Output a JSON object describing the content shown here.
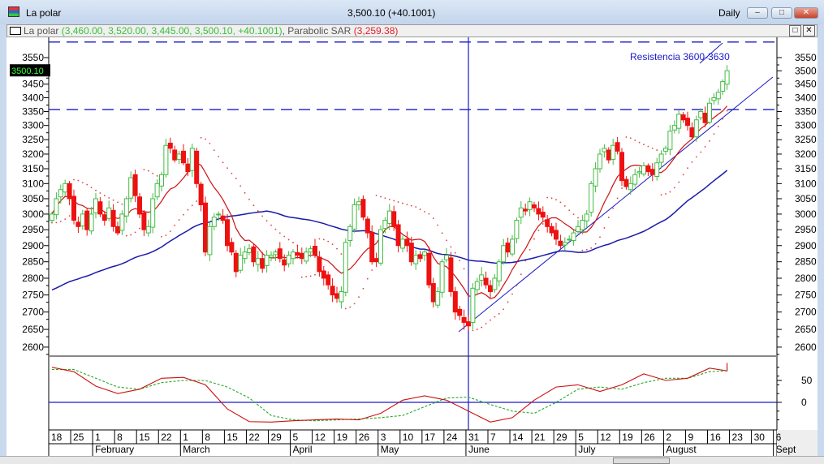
{
  "window": {
    "title": "La polar",
    "quote": "3,500.10 (+40.1001)",
    "period": "Daily",
    "minimize": "–",
    "maximize": "□",
    "close": "✕"
  },
  "legend": {
    "symbol": "La polar",
    "ohlc": "(3,460.00, 3,520.00, 3,445.00, 3,500.10, +40.1001)",
    "sep": ", ",
    "indicator": "Parabolic SAR",
    "indicator_value": "(3,259.38)",
    "restore": "□",
    "close": "✕"
  },
  "price_tag": "3500.10",
  "annotation": "Resistencia 3600-3630",
  "colors": {
    "up": "#44bb44",
    "down": "#ee1111",
    "ma_fast": "#cc1111",
    "ma_slow": "#1a1aa8",
    "sar": "#e04040",
    "lines": "#1a1ac8",
    "osc_red": "#cc1111",
    "osc_green": "#22aa22"
  },
  "chart_data": {
    "type": "candlestick",
    "title": "La polar",
    "scale": "log",
    "ylim": [
      2575,
      3620
    ],
    "yticks": [
      2600,
      2650,
      2700,
      2750,
      2800,
      2850,
      2900,
      2950,
      3000,
      3050,
      3100,
      3150,
      3200,
      3250,
      3300,
      3350,
      3400,
      3450,
      3500,
      3550
    ],
    "closes": [
      3000,
      3050,
      3080,
      3100,
      3050,
      2980,
      2960,
      3000,
      2950,
      3000,
      3050,
      3000,
      2980,
      3020,
      2960,
      2940,
      3000,
      3050,
      3120,
      3060,
      3000,
      2950,
      2960,
      3050,
      3100,
      3130,
      3230,
      3220,
      3180,
      3200,
      3170,
      3140,
      3220,
      3100,
      3030,
      2880,
      2960,
      2990,
      3000,
      2980,
      2900,
      2880,
      2820,
      2870,
      2880,
      2890,
      2850,
      2860,
      2830,
      2870,
      2870,
      2880,
      2860,
      2840,
      2870,
      2880,
      2870,
      2860,
      2880,
      2890,
      2870,
      2820,
      2800,
      2780,
      2750,
      2740,
      2760,
      2910,
      2960,
      3030,
      3040,
      2990,
      2940,
      2850,
      2850,
      2950,
      2980,
      3010,
      2960,
      2900,
      2920,
      2900,
      2850,
      2870,
      2860,
      2880,
      2780,
      2730,
      2760,
      2850,
      2870,
      2760,
      2700,
      2690,
      2670,
      2660,
      2770,
      2790,
      2810,
      2780,
      2760,
      2800,
      2850,
      2900,
      2880,
      2920,
      2980,
      3020,
      3010,
      3040,
      3020,
      3000,
      2990,
      2960,
      2940,
      2920,
      2900,
      2910,
      2920,
      2940,
      2960,
      2980,
      3000,
      3100,
      3150,
      3200,
      3220,
      3180,
      3230,
      3210,
      3110,
      3090,
      3100,
      3130,
      3140,
      3160,
      3140,
      3130,
      3170,
      3200,
      3220,
      3280,
      3300,
      3340,
      3320,
      3300,
      3260,
      3320,
      3350,
      3310,
      3380,
      3400,
      3420,
      3460,
      3500.1
    ],
    "moving_averages": [
      {
        "name": "MA 10",
        "period": 10
      },
      {
        "name": "MA 50",
        "period": 50
      }
    ],
    "parabolic_sar": {
      "step": 0.02,
      "max": 0.2,
      "last": 3259.38
    },
    "horizontal_lines": [
      3610,
      3357
    ],
    "crosshair_day_index": 95,
    "oscillator": {
      "yticks": [
        50,
        0
      ],
      "ylim": [
        -63,
        104
      ],
      "red": [
        80,
        70,
        37,
        20,
        30,
        55,
        57,
        40,
        -15,
        -44,
        -45,
        -42,
        -40,
        -38,
        -40,
        -25,
        5,
        15,
        5,
        -20,
        -45,
        -35,
        5,
        35,
        40,
        25,
        40,
        65,
        50,
        55,
        78,
        72,
        90
      ],
      "green": [
        75,
        75,
        55,
        35,
        30,
        45,
        50,
        50,
        35,
        10,
        -30,
        -40,
        -42,
        -40,
        -38,
        -35,
        -30,
        -10,
        10,
        12,
        -5,
        -20,
        -25,
        0,
        30,
        35,
        30,
        45,
        55,
        55,
        70,
        72,
        80
      ]
    },
    "x_days": [
      "18",
      "25",
      "1",
      "8",
      "15",
      "22",
      "1",
      "8",
      "15",
      "22",
      "29",
      "5",
      "12",
      "19",
      "26",
      "3",
      "10",
      "17",
      "24",
      "31",
      "7",
      "14",
      "21",
      "29",
      "5",
      "12",
      "19",
      "26",
      "2",
      "9",
      "16",
      "23",
      "30",
      "6"
    ],
    "x_months": [
      {
        "label": "February",
        "week": 2
      },
      {
        "label": "March",
        "week": 6
      },
      {
        "label": "April",
        "week": 11
      },
      {
        "label": "May",
        "week": 15
      },
      {
        "label": "June",
        "week": 19
      },
      {
        "label": "July",
        "week": 24
      },
      {
        "label": "August",
        "week": 28
      },
      {
        "label": "Sept",
        "week": 33
      }
    ]
  }
}
